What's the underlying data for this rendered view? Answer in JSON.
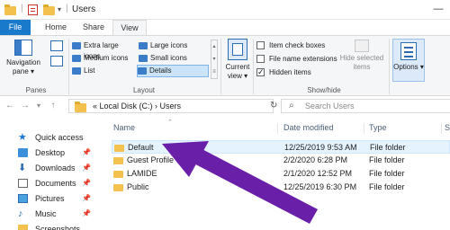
{
  "window": {
    "title": "Users",
    "minimize": "—"
  },
  "ribbon_tabs": [
    "File",
    "Home",
    "Share",
    "View"
  ],
  "ribbon": {
    "panes": {
      "navigation_pane": "Navigation pane ▾",
      "group": "Panes"
    },
    "layout": {
      "options": [
        "Extra large icons",
        "Large icons",
        "Medium icons",
        "Small icons",
        "List",
        "Details"
      ],
      "selected": "Details",
      "group": "Layout"
    },
    "current_view": {
      "label": "Current view ▾"
    },
    "show_hide": {
      "item_check_boxes": {
        "label": "Item check boxes",
        "checked": false
      },
      "file_name_extensions": {
        "label": "File name extensions",
        "checked": false
      },
      "hidden_items": {
        "label": "Hidden items",
        "checked": true
      },
      "hide_selected": "Hide selected items",
      "group": "Show/hide"
    },
    "options": {
      "label": "Options ▾"
    }
  },
  "address": {
    "path": "« Local Disk (C:) › Users",
    "search_placeholder": "Search Users"
  },
  "nav_pane": {
    "items": [
      {
        "label": "Quick access",
        "icon": "star-icon",
        "pinned": false
      },
      {
        "label": "Desktop",
        "icon": "desktop-icon",
        "pinned": true
      },
      {
        "label": "Downloads",
        "icon": "download-icon",
        "pinned": true
      },
      {
        "label": "Documents",
        "icon": "documents-icon",
        "pinned": true
      },
      {
        "label": "Pictures",
        "icon": "pictures-icon",
        "pinned": true
      },
      {
        "label": "Music",
        "icon": "music-icon",
        "pinned": true
      },
      {
        "label": "Screenshots",
        "icon": "folder-icon",
        "pinned": false
      }
    ],
    "pin_glyph": "📌"
  },
  "file_list": {
    "columns": {
      "name": "Name",
      "date": "Date modified",
      "type": "Type",
      "size": "Si"
    },
    "rows": [
      {
        "name": "Default",
        "date": "12/25/2019 9:53 AM",
        "type": "File folder"
      },
      {
        "name": "Guest Profile",
        "date": "2/2/2020 6:28 PM",
        "type": "File folder"
      },
      {
        "name": "LAMIDE",
        "date": "2/1/2020 12:52 PM",
        "type": "File folder"
      },
      {
        "name": "Public",
        "date": "12/25/2019 6:30 PM",
        "type": "File folder"
      }
    ],
    "selected_row": 0
  },
  "colors": {
    "accent": "#1979ca",
    "arrow": "#6a1fa8",
    "folder": "#f2c14e"
  }
}
